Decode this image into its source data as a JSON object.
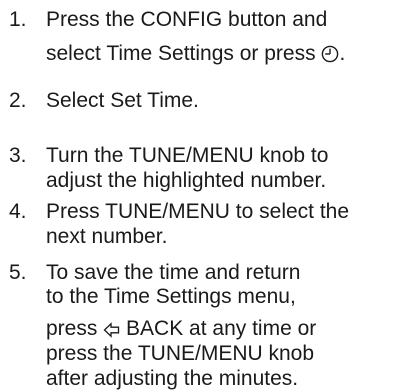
{
  "steps": [
    {
      "number": "1.",
      "lines": [
        [
          "Press the CONFIG button and"
        ],
        [
          "select Time Settings or press ",
          {
            "icon": "clock-icon"
          },
          "."
        ]
      ]
    },
    {
      "number": "2.",
      "lines": [
        [
          "Select Set Time."
        ]
      ]
    },
    {
      "number": "3.",
      "lines": [
        [
          "Turn the TUNE/MENU knob to"
        ],
        [
          "adjust the highlighted number."
        ]
      ]
    },
    {
      "number": "4.",
      "lines": [
        [
          "Press TUNE/MENU to select the"
        ],
        [
          "next number."
        ]
      ]
    },
    {
      "number": "5.",
      "lines": [
        [
          "To save the time and return"
        ],
        [
          "to the Time Settings menu,"
        ],
        [
          "press ",
          {
            "icon": "back-arrow-icon"
          },
          " BACK at any time or"
        ],
        [
          "press the TUNE/MENU knob"
        ],
        [
          "after adjusting the minutes."
        ]
      ]
    }
  ]
}
